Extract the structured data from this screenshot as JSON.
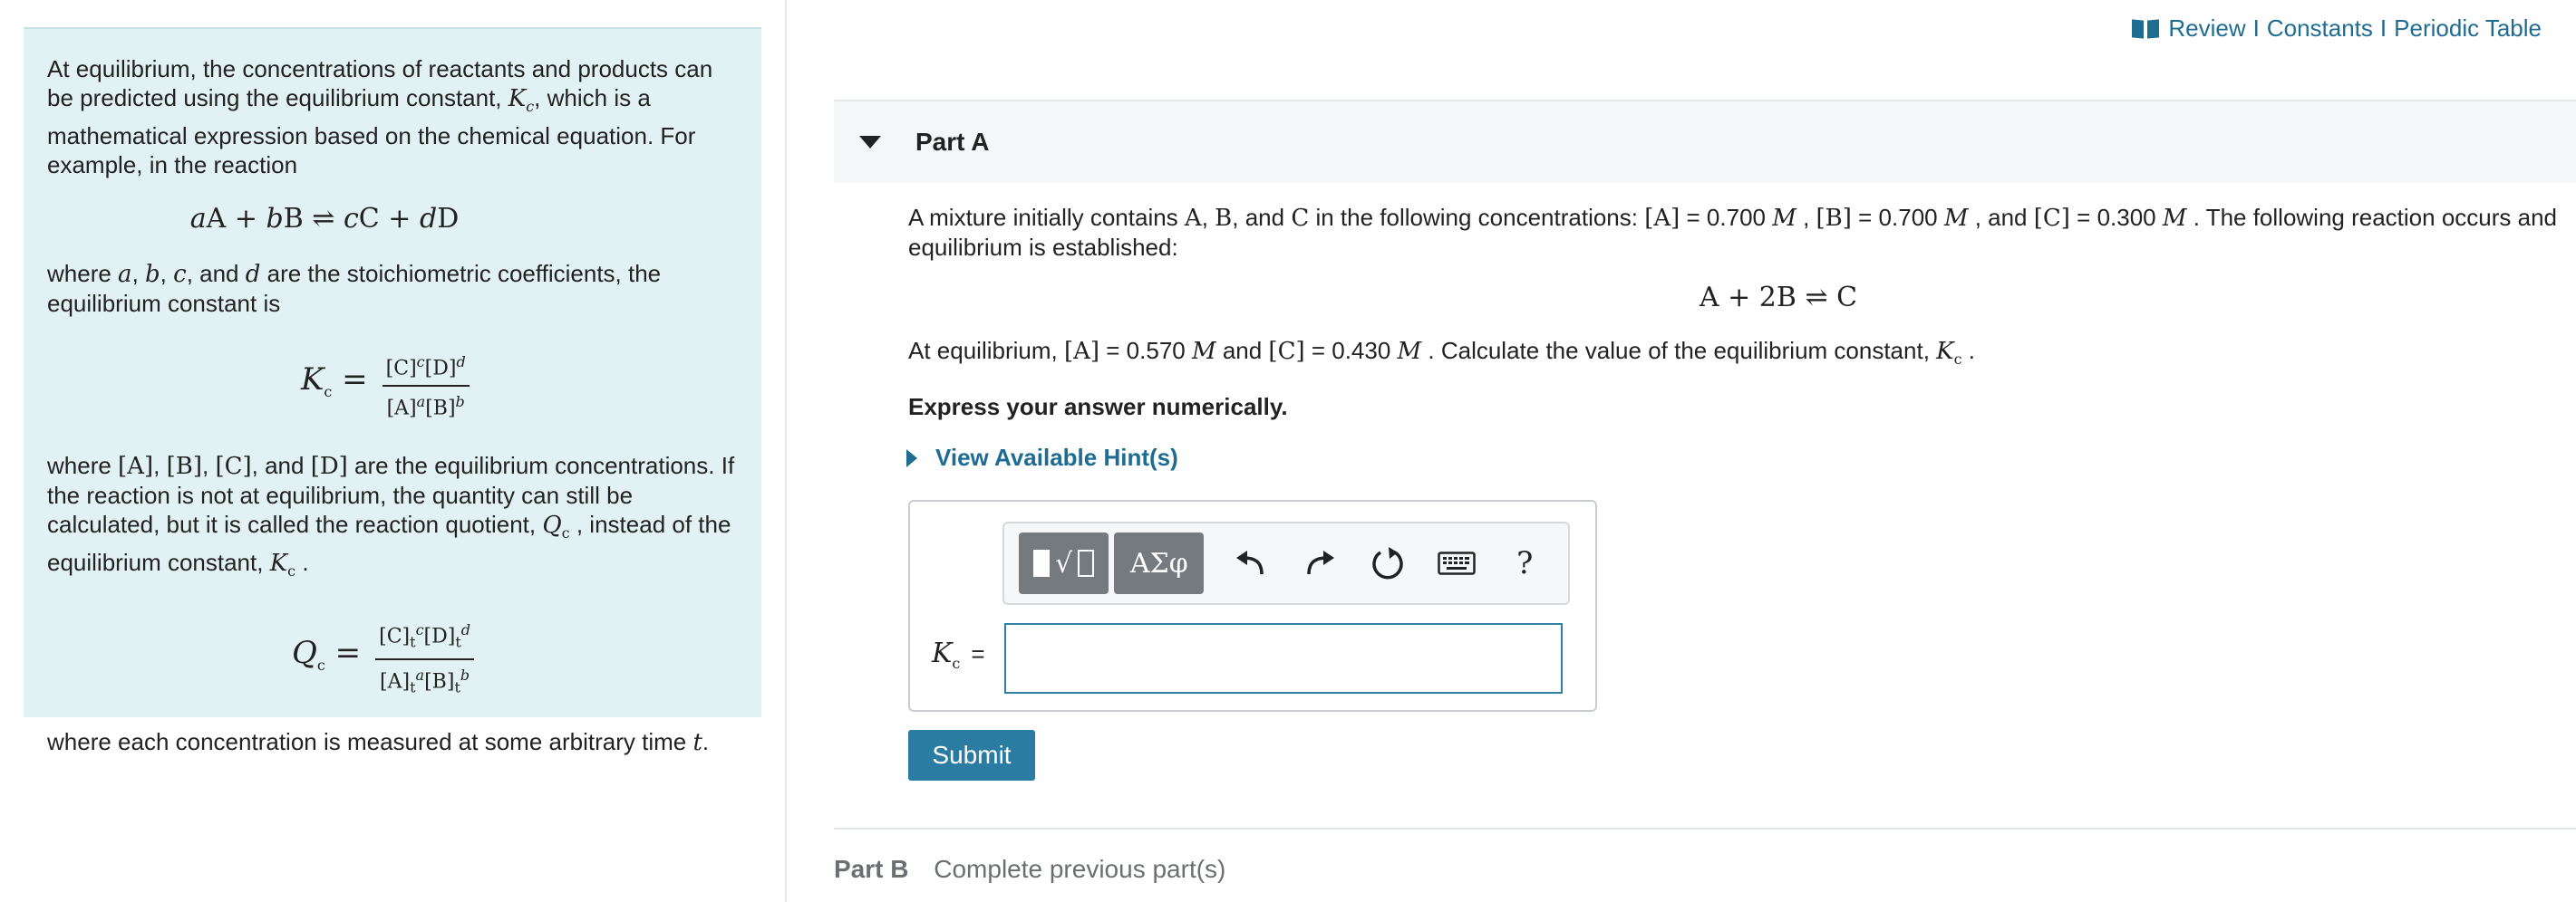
{
  "top_links": {
    "review": "Review",
    "constants": "Constants",
    "periodic_table": "Periodic Table",
    "separator": "I"
  },
  "left_panel": {
    "para1": "At equilibrium, the concentrations of reactants and products can be predicted using the equilibrium constant,",
    "para1_symbol": "Kc",
    "para1_tail": ", which is a mathematical expression based on the chemical equation. For example, in the reaction",
    "general_reaction": "aA + bB ⇌ cC + dD",
    "para2": "where a, b, c, and d are the stoichiometric coefficients, the equilibrium constant is",
    "kc_formula": "Kc = [C]^c[D]^d / [A]^a[B]^b",
    "para3": "where [A], [B], [C], and [D] are the equilibrium concentrations. If the reaction is not at equilibrium, the quantity can still be calculated, but it is called the reaction quotient, Qc , instead of the equilibrium constant, Kc .",
    "qc_formula": "Qc = [C]t^c[D]t^d / [A]t^a[B]t^b",
    "para4": "where each concentration is measured at some arbitrary time t."
  },
  "partA": {
    "title": "Part A",
    "question_line1": "A mixture initially contains A, B, and C in the following concentrations: [A] = 0.700 M , [B] = 0.700 M , and [C] = 0.300 M . The following reaction occurs and equilibrium is established:",
    "reaction": "A + 2B ⇌ C",
    "question_line2": "At equilibrium, [A] = 0.570 M and [C] = 0.430 M . Calculate the value of the equilibrium constant, Kc .",
    "instruction": "Express your answer numerically.",
    "hint_label": "View Available Hint(s)",
    "answer_label": "Kc",
    "answer_equals": "=",
    "answer_value": "",
    "toolbar": {
      "greek": "ΑΣφ",
      "help": "?"
    },
    "submit_label": "Submit"
  },
  "partB": {
    "label": "Part B",
    "status": "Complete previous part(s)"
  }
}
